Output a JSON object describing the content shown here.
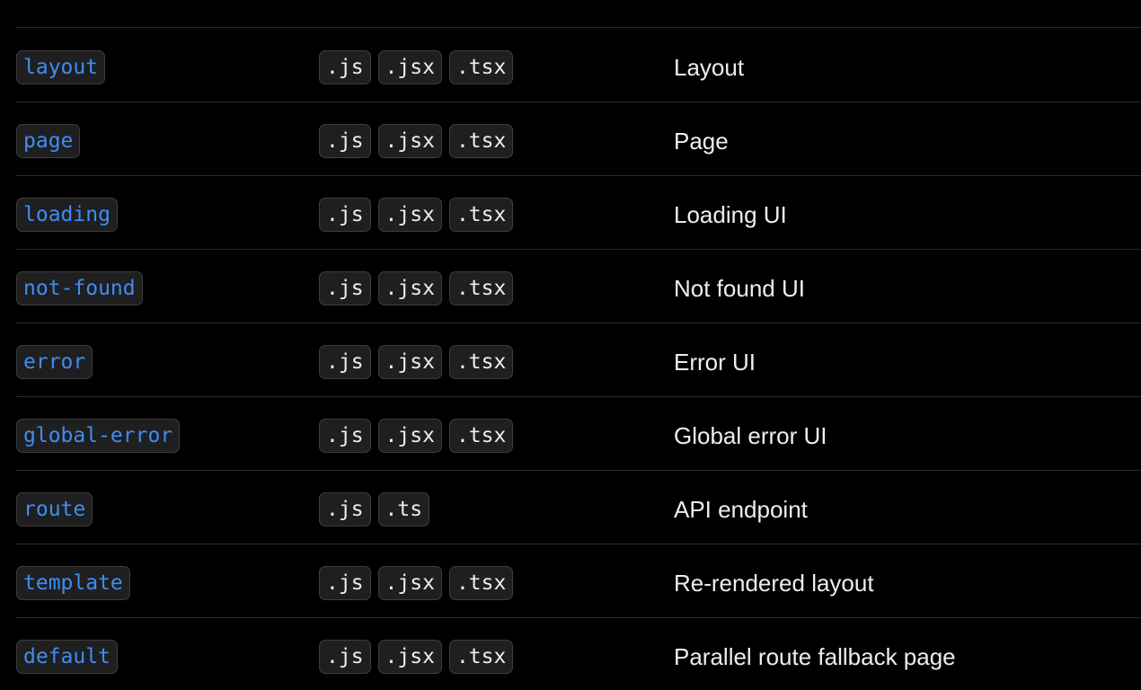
{
  "table": {
    "rows": [
      {
        "file": "layout",
        "exts": [
          ".js",
          ".jsx",
          ".tsx"
        ],
        "description": "Layout"
      },
      {
        "file": "page",
        "exts": [
          ".js",
          ".jsx",
          ".tsx"
        ],
        "description": "Page"
      },
      {
        "file": "loading",
        "exts": [
          ".js",
          ".jsx",
          ".tsx"
        ],
        "description": "Loading UI"
      },
      {
        "file": "not-found",
        "exts": [
          ".js",
          ".jsx",
          ".tsx"
        ],
        "description": "Not found UI"
      },
      {
        "file": "error",
        "exts": [
          ".js",
          ".jsx",
          ".tsx"
        ],
        "description": "Error UI"
      },
      {
        "file": "global-error",
        "exts": [
          ".js",
          ".jsx",
          ".tsx"
        ],
        "description": "Global error UI"
      },
      {
        "file": "route",
        "exts": [
          ".js",
          ".ts"
        ],
        "description": "API endpoint"
      },
      {
        "file": "template",
        "exts": [
          ".js",
          ".jsx",
          ".tsx"
        ],
        "description": "Re-rendered layout"
      },
      {
        "file": "default",
        "exts": [
          ".js",
          ".jsx",
          ".tsx"
        ],
        "description": "Parallel route fallback page"
      }
    ]
  },
  "colors": {
    "background": "#000000",
    "file_name_text": "#3f8cf5",
    "text": "#ededed",
    "code_background": "#1f1f1f",
    "code_border": "#3d3d3d",
    "row_divider": "#2a2a2a"
  }
}
